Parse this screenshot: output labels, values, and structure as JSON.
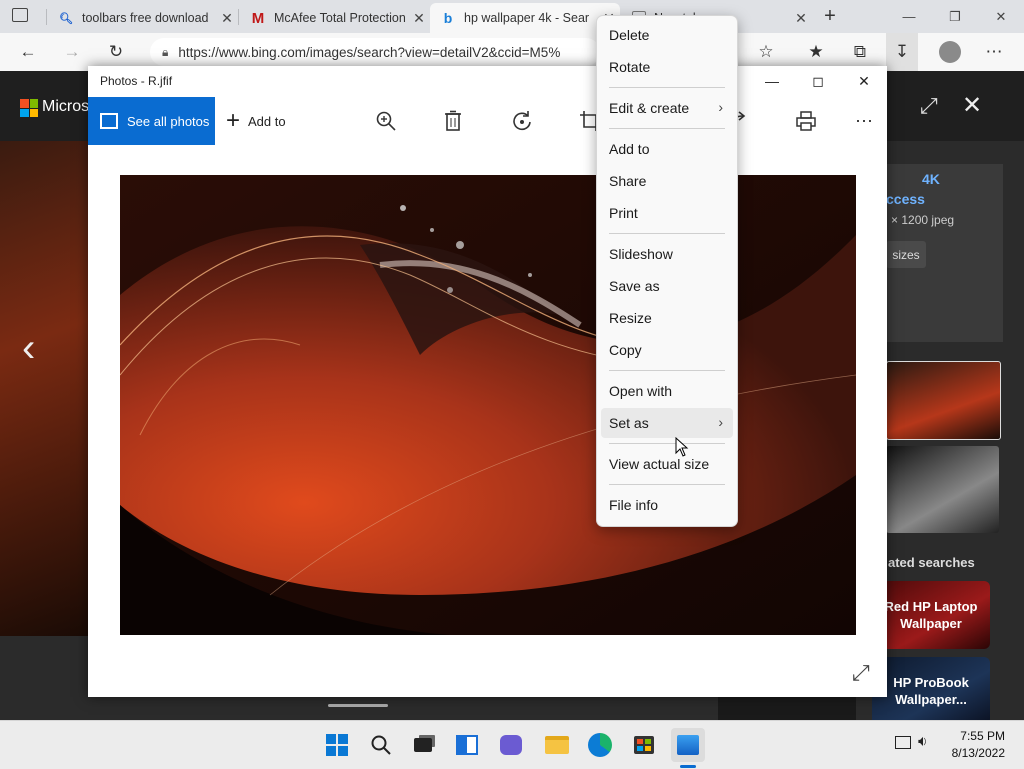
{
  "browser": {
    "tabs": [
      {
        "title": "toolbars free download",
        "icon": "search-icon"
      },
      {
        "title": "McAfee Total Protection",
        "icon": "mcafee-icon"
      },
      {
        "title": "hp wallpaper 4k - Sear",
        "icon": "bing-icon"
      },
      {
        "title": "New tab",
        "icon": "new-tab-icon"
      }
    ],
    "url": "https://www.bing.com/images/search?view=detailV2&ccid=M5%"
  },
  "bing": {
    "logo_text": "Micros",
    "info_title": "4K",
    "info_sub": "ccess",
    "info_size": "× 1200 jpeg",
    "sizes_button": "sizes",
    "related_heading": "ated searches",
    "related": [
      "Red HP Laptop Wallpaper",
      "HP ProBook Wallpaper..."
    ]
  },
  "photos": {
    "title": "Photos - R.jfif",
    "see_all": "See all photos",
    "add_to": "Add to"
  },
  "context_menu": {
    "items": [
      "Delete",
      "Rotate",
      "Edit & create",
      "Add to",
      "Share",
      "Print",
      "Slideshow",
      "Save as",
      "Resize",
      "Copy",
      "Open with",
      "Set as",
      "View actual size",
      "File info"
    ]
  },
  "taskbar": {
    "time": "7:55 PM",
    "date": "8/13/2022"
  },
  "colors": {
    "accent": "#0a6cd1",
    "wallpaper_red": "#c2401a"
  }
}
